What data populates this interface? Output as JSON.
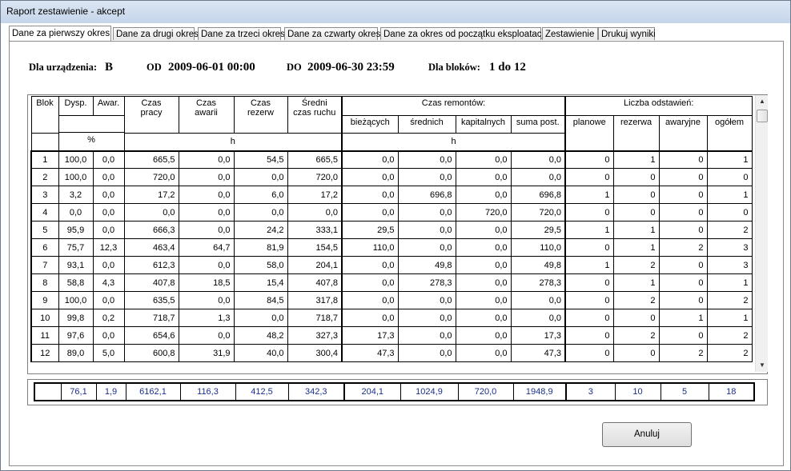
{
  "window": {
    "title": "Raport zestawienie - akcept"
  },
  "tabs": [
    {
      "label": "Dane za pierwszy okres",
      "active": true
    },
    {
      "label": "Dane za drugi okres"
    },
    {
      "label": "Dane za trzeci okres"
    },
    {
      "label": "Dane za czwarty okres"
    },
    {
      "label": "Dane za okres od początku eksploatacji"
    },
    {
      "label": "Zestawienie"
    },
    {
      "label": "Drukuj wyniki"
    }
  ],
  "info": {
    "device_label": "Dla urządzenia:",
    "device_value": "B",
    "od_label": "OD",
    "od_value": "2009-06-01 00:00",
    "do_label": "DO",
    "do_value": "2009-06-30 23:59",
    "blocks_label": "Dla bloków:",
    "blocks_value": "1 do 12"
  },
  "headers": {
    "blok": "Blok",
    "dysp": "Dysp.",
    "awar": "Awar.",
    "czas_pracy": [
      "Czas",
      "pracy"
    ],
    "czas_awarii": [
      "Czas",
      "awarii"
    ],
    "czas_rezerw": [
      "Czas",
      "rezerw"
    ],
    "sredni": [
      "Średni",
      "czas ruchu"
    ],
    "remontow": "Czas remontów:",
    "biezacych": "bieżących",
    "srednich": "średnich",
    "kapitalnych": "kapitalnych",
    "suma_post": "suma post.",
    "odstawien": "Liczba odstawień:",
    "planowe": "planowe",
    "rezerwa": "rezerwa",
    "awaryjne": "awaryjne",
    "ogolem": "ogółem",
    "unit_percent": "%",
    "unit_h1": "h",
    "unit_h2": "h"
  },
  "rows": [
    [
      "1",
      "100,0",
      "0,0",
      "665,5",
      "0,0",
      "54,5",
      "665,5",
      "0,0",
      "0,0",
      "0,0",
      "0,0",
      "0",
      "1",
      "0",
      "1"
    ],
    [
      "2",
      "100,0",
      "0,0",
      "720,0",
      "0,0",
      "0,0",
      "720,0",
      "0,0",
      "0,0",
      "0,0",
      "0,0",
      "0",
      "0",
      "0",
      "0"
    ],
    [
      "3",
      "3,2",
      "0,0",
      "17,2",
      "0,0",
      "6,0",
      "17,2",
      "0,0",
      "696,8",
      "0,0",
      "696,8",
      "1",
      "0",
      "0",
      "1"
    ],
    [
      "4",
      "0,0",
      "0,0",
      "0,0",
      "0,0",
      "0,0",
      "0,0",
      "0,0",
      "0,0",
      "720,0",
      "720,0",
      "0",
      "0",
      "0",
      "0"
    ],
    [
      "5",
      "95,9",
      "0,0",
      "666,3",
      "0,0",
      "24,2",
      "333,1",
      "29,5",
      "0,0",
      "0,0",
      "29,5",
      "1",
      "1",
      "0",
      "2"
    ],
    [
      "6",
      "75,7",
      "12,3",
      "463,4",
      "64,7",
      "81,9",
      "154,5",
      "110,0",
      "0,0",
      "0,0",
      "110,0",
      "0",
      "1",
      "2",
      "3"
    ],
    [
      "7",
      "93,1",
      "0,0",
      "612,3",
      "0,0",
      "58,0",
      "204,1",
      "0,0",
      "49,8",
      "0,0",
      "49,8",
      "1",
      "2",
      "0",
      "3"
    ],
    [
      "8",
      "58,8",
      "4,3",
      "407,8",
      "18,5",
      "15,4",
      "407,8",
      "0,0",
      "278,3",
      "0,0",
      "278,3",
      "0",
      "1",
      "0",
      "1"
    ],
    [
      "9",
      "100,0",
      "0,0",
      "635,5",
      "0,0",
      "84,5",
      "317,8",
      "0,0",
      "0,0",
      "0,0",
      "0,0",
      "0",
      "2",
      "0",
      "2"
    ],
    [
      "10",
      "99,8",
      "0,2",
      "718,7",
      "1,3",
      "0,0",
      "718,7",
      "0,0",
      "0,0",
      "0,0",
      "0,0",
      "0",
      "0",
      "1",
      "1"
    ],
    [
      "11",
      "97,6",
      "0,0",
      "654,6",
      "0,0",
      "48,2",
      "327,3",
      "17,3",
      "0,0",
      "0,0",
      "17,3",
      "0",
      "2",
      "0",
      "2"
    ],
    [
      "12",
      "89,0",
      "5,0",
      "600,8",
      "31,9",
      "40,0",
      "300,4",
      "47,3",
      "0,0",
      "0,0",
      "47,3",
      "0",
      "0",
      "2",
      "2"
    ]
  ],
  "totals": [
    "76,1",
    "1,9",
    "6162,1",
    "116,3",
    "412,5",
    "342,3",
    "204,1",
    "1024,9",
    "720,0",
    "1948,9",
    "3",
    "10",
    "5",
    "18"
  ],
  "cancel_label": "Anuluj",
  "scroll_up": "▲",
  "scroll_down": "▼"
}
